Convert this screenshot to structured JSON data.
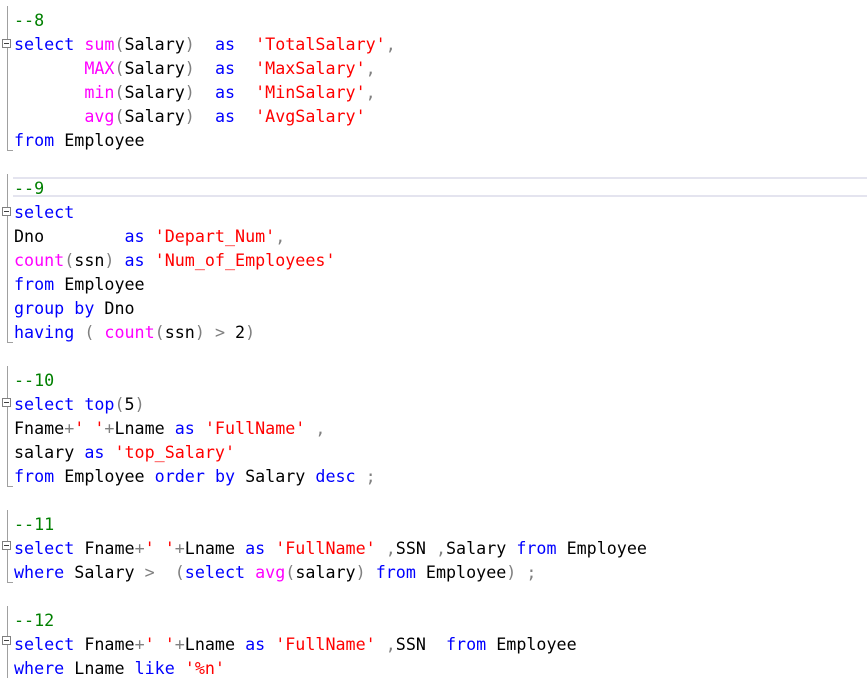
{
  "editor": {
    "colors": {
      "keyword": "#0000ff",
      "function": "#ff00ff",
      "string": "#ff0000",
      "operator": "#808080",
      "comment": "#008000",
      "identifier": "#000000",
      "background": "#ffffff"
    },
    "lines": [
      [
        [
          "cmt",
          "--8"
        ]
      ],
      [
        [
          "kw",
          "select"
        ],
        [
          "id",
          " "
        ],
        [
          "fn",
          "sum"
        ],
        [
          "op",
          "("
        ],
        [
          "id",
          "Salary"
        ],
        [
          "op",
          ")"
        ],
        [
          "id",
          "  "
        ],
        [
          "kw",
          "as"
        ],
        [
          "id",
          "  "
        ],
        [
          "str",
          "'TotalSalary'"
        ],
        [
          "op",
          ","
        ]
      ],
      [
        [
          "id",
          "       "
        ],
        [
          "fn",
          "MAX"
        ],
        [
          "op",
          "("
        ],
        [
          "id",
          "Salary"
        ],
        [
          "op",
          ")"
        ],
        [
          "id",
          "  "
        ],
        [
          "kw",
          "as"
        ],
        [
          "id",
          "  "
        ],
        [
          "str",
          "'MaxSalary'"
        ],
        [
          "op",
          ","
        ]
      ],
      [
        [
          "id",
          "       "
        ],
        [
          "fn",
          "min"
        ],
        [
          "op",
          "("
        ],
        [
          "id",
          "Salary"
        ],
        [
          "op",
          ")"
        ],
        [
          "id",
          "  "
        ],
        [
          "kw",
          "as"
        ],
        [
          "id",
          "  "
        ],
        [
          "str",
          "'MinSalary'"
        ],
        [
          "op",
          ","
        ]
      ],
      [
        [
          "id",
          "       "
        ],
        [
          "fn",
          "avg"
        ],
        [
          "op",
          "("
        ],
        [
          "id",
          "Salary"
        ],
        [
          "op",
          ")"
        ],
        [
          "id",
          "  "
        ],
        [
          "kw",
          "as"
        ],
        [
          "id",
          "  "
        ],
        [
          "str",
          "'AvgSalary'"
        ]
      ],
      [
        [
          "kw",
          "from"
        ],
        [
          "id",
          " Employee"
        ]
      ],
      [],
      [
        [
          "cmt",
          "--9"
        ]
      ],
      [
        [
          "kw",
          "select"
        ]
      ],
      [
        [
          "id",
          "Dno        "
        ],
        [
          "kw",
          "as"
        ],
        [
          "id",
          " "
        ],
        [
          "str",
          "'Depart_Num'"
        ],
        [
          "op",
          ","
        ]
      ],
      [
        [
          "fn",
          "count"
        ],
        [
          "op",
          "("
        ],
        [
          "id",
          "ssn"
        ],
        [
          "op",
          ")"
        ],
        [
          "id",
          " "
        ],
        [
          "kw",
          "as"
        ],
        [
          "id",
          " "
        ],
        [
          "str",
          "'Num_of_Employees'"
        ]
      ],
      [
        [
          "kw",
          "from"
        ],
        [
          "id",
          " Employee"
        ]
      ],
      [
        [
          "kw",
          "group"
        ],
        [
          "id",
          " "
        ],
        [
          "kw",
          "by"
        ],
        [
          "id",
          " Dno"
        ]
      ],
      [
        [
          "kw",
          "having"
        ],
        [
          "id",
          " "
        ],
        [
          "op",
          "("
        ],
        [
          "id",
          " "
        ],
        [
          "fn",
          "count"
        ],
        [
          "op",
          "("
        ],
        [
          "id",
          "ssn"
        ],
        [
          "op",
          ")"
        ],
        [
          "id",
          " "
        ],
        [
          "op",
          ">"
        ],
        [
          "id",
          " 2"
        ],
        [
          "op",
          ")"
        ]
      ],
      [],
      [
        [
          "cmt",
          "--10"
        ]
      ],
      [
        [
          "kw",
          "select"
        ],
        [
          "id",
          " "
        ],
        [
          "kw",
          "top"
        ],
        [
          "op",
          "("
        ],
        [
          "id",
          "5"
        ],
        [
          "op",
          ")"
        ]
      ],
      [
        [
          "id",
          "Fname"
        ],
        [
          "op",
          "+"
        ],
        [
          "str",
          "' '"
        ],
        [
          "op",
          "+"
        ],
        [
          "id",
          "Lname "
        ],
        [
          "kw",
          "as"
        ],
        [
          "id",
          " "
        ],
        [
          "str",
          "'FullName'"
        ],
        [
          "id",
          " "
        ],
        [
          "op",
          ","
        ]
      ],
      [
        [
          "id",
          "salary "
        ],
        [
          "kw",
          "as"
        ],
        [
          "id",
          " "
        ],
        [
          "str",
          "'top_Salary'"
        ]
      ],
      [
        [
          "kw",
          "from"
        ],
        [
          "id",
          " Employee "
        ],
        [
          "kw",
          "order"
        ],
        [
          "id",
          " "
        ],
        [
          "kw",
          "by"
        ],
        [
          "id",
          " Salary "
        ],
        [
          "kw",
          "desc"
        ],
        [
          "id",
          " "
        ],
        [
          "op",
          ";"
        ]
      ],
      [],
      [
        [
          "cmt",
          "--11"
        ]
      ],
      [
        [
          "kw",
          "select"
        ],
        [
          "id",
          " Fname"
        ],
        [
          "op",
          "+"
        ],
        [
          "str",
          "' '"
        ],
        [
          "op",
          "+"
        ],
        [
          "id",
          "Lname "
        ],
        [
          "kw",
          "as"
        ],
        [
          "id",
          " "
        ],
        [
          "str",
          "'FullName'"
        ],
        [
          "id",
          " "
        ],
        [
          "op",
          ","
        ],
        [
          "id",
          "SSN "
        ],
        [
          "op",
          ","
        ],
        [
          "id",
          "Salary "
        ],
        [
          "kw",
          "from"
        ],
        [
          "id",
          " Employee"
        ]
      ],
      [
        [
          "kw",
          "where"
        ],
        [
          "id",
          " Salary "
        ],
        [
          "op",
          ">"
        ],
        [
          "id",
          "  "
        ],
        [
          "op",
          "("
        ],
        [
          "kw",
          "select"
        ],
        [
          "id",
          " "
        ],
        [
          "fn",
          "avg"
        ],
        [
          "op",
          "("
        ],
        [
          "id",
          "salary"
        ],
        [
          "op",
          ")"
        ],
        [
          "id",
          " "
        ],
        [
          "kw",
          "from"
        ],
        [
          "id",
          " Employee"
        ],
        [
          "op",
          ")"
        ],
        [
          "id",
          " "
        ],
        [
          "op",
          ";"
        ]
      ],
      [],
      [
        [
          "cmt",
          "--12"
        ]
      ],
      [
        [
          "kw",
          "select"
        ],
        [
          "id",
          " Fname"
        ],
        [
          "op",
          "+"
        ],
        [
          "str",
          "' '"
        ],
        [
          "op",
          "+"
        ],
        [
          "id",
          "Lname "
        ],
        [
          "kw",
          "as"
        ],
        [
          "id",
          " "
        ],
        [
          "str",
          "'FullName'"
        ],
        [
          "id",
          " "
        ],
        [
          "op",
          ","
        ],
        [
          "id",
          "SSN  "
        ],
        [
          "kw",
          "from"
        ],
        [
          "id",
          " Employee"
        ]
      ],
      [
        [
          "kw",
          "where"
        ],
        [
          "id",
          " Lname "
        ],
        [
          "kw",
          "like"
        ],
        [
          "id",
          " "
        ],
        [
          "str",
          "'%n'"
        ]
      ]
    ]
  }
}
